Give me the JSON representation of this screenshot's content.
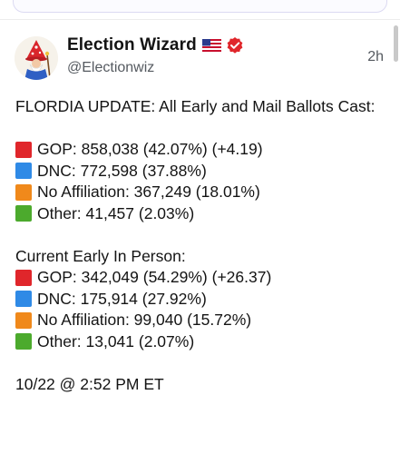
{
  "colors": {
    "red": "#e0262b",
    "blue": "#2f8ae6",
    "orange": "#f0891b",
    "green": "#4caa2d",
    "verified": "#e0262b"
  },
  "post": {
    "display_name": "Election Wizard",
    "handle": "@Electionwiz",
    "time": "2h",
    "intro": "FLORDIA UPDATE: All Early and Mail Ballots Cast:",
    "section1": [
      {
        "icon": "red-square-icon",
        "text": "GOP: 858,038 (42.07%) (+4.19)"
      },
      {
        "icon": "blue-square-icon",
        "text": "DNC: 772,598 (37.88%)"
      },
      {
        "icon": "orange-square-icon",
        "text": "No Affiliation: 367,249 (18.01%)"
      },
      {
        "icon": "green-square-icon",
        "text": "Other: 41,457 (2.03%)"
      }
    ],
    "section2_title": "Current Early In Person:",
    "section2": [
      {
        "icon": "red-square-icon",
        "text": "GOP: 342,049 (54.29%) (+26.37)"
      },
      {
        "icon": "blue-square-icon",
        "text": "DNC: 175,914 (27.92%)"
      },
      {
        "icon": "orange-square-icon",
        "text": "No Affiliation: 99,040 (15.72%)"
      },
      {
        "icon": "green-square-icon",
        "text": "Other: 13,041 (2.07%)"
      }
    ],
    "timestamp": "10/22 @ 2:52 PM ET"
  }
}
